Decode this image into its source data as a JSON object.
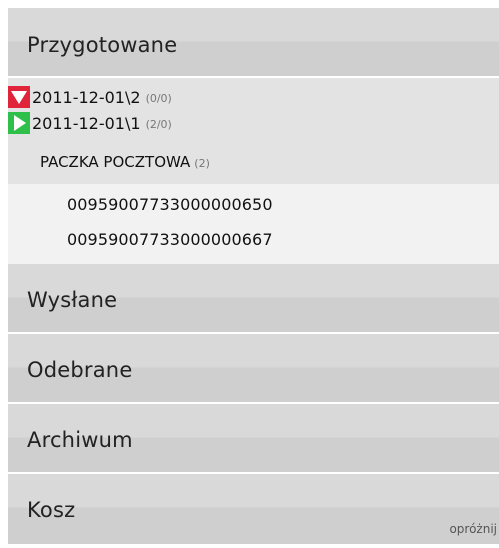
{
  "sections": {
    "prepared": {
      "label": "Przygotowane"
    },
    "sent": {
      "label": "Wysłane"
    },
    "received": {
      "label": "Odebrane"
    },
    "archive": {
      "label": "Archiwum"
    },
    "trash": {
      "label": "Kosz",
      "action": "opróżnij"
    }
  },
  "tree": {
    "batches": [
      {
        "label": "2011-12-01\\2",
        "count": "(0/0)",
        "state": "expanded",
        "icon": "arrow-down-icon"
      },
      {
        "label": "2011-12-01\\1",
        "count": "(2/0)",
        "state": "collapsed",
        "icon": "arrow-right-icon"
      }
    ],
    "group": {
      "label": "PACZKA POCZTOWA",
      "count": "(2)"
    },
    "items": [
      "00959007733000000650",
      "00959007733000000667"
    ]
  },
  "colors": {
    "expanded_toggle": "#e0243a",
    "collapsed_toggle": "#2ec04a",
    "header_bg": "#d9d9d9",
    "tree_bg": "#e3e3e3",
    "items_bg": "#f2f2f2"
  }
}
